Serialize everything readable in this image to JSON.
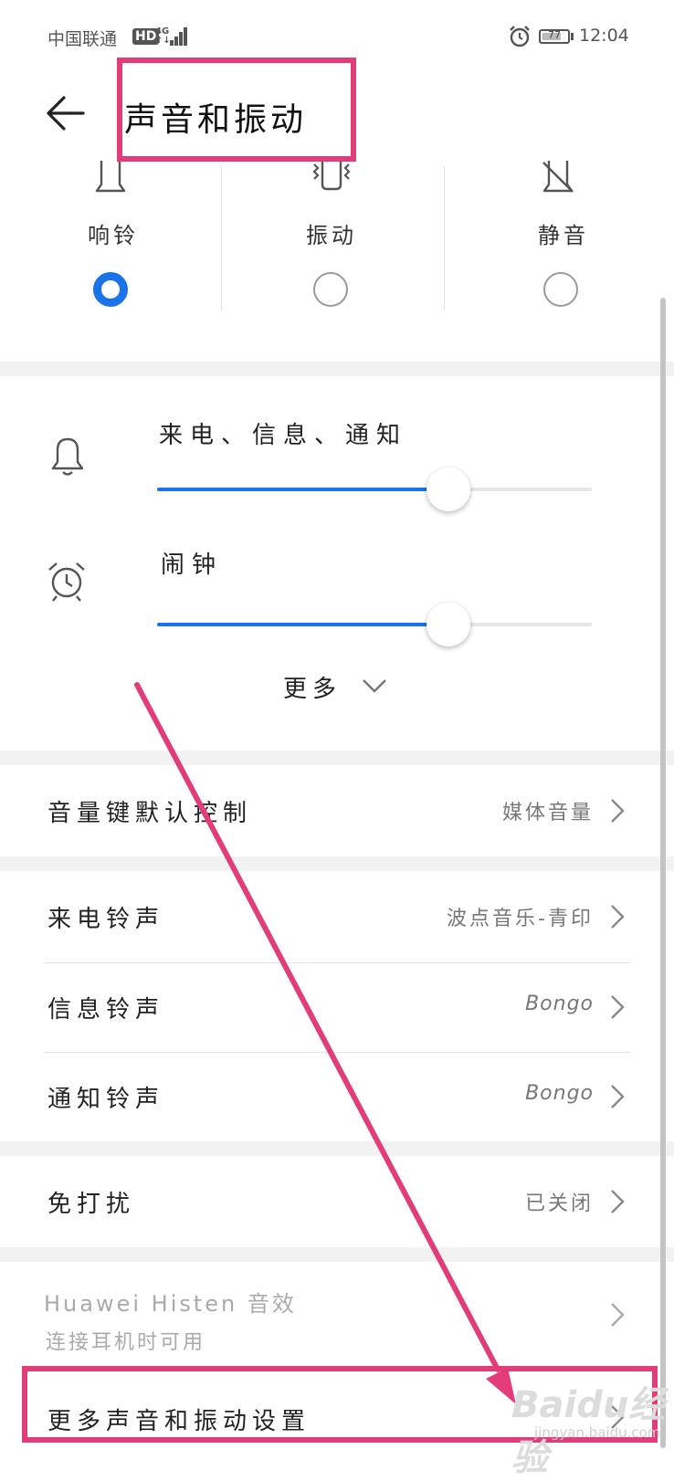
{
  "status_bar": {
    "carrier": "中国联通",
    "hd": "HD",
    "network_type": "4G",
    "battery_level": "77",
    "time": "12:04"
  },
  "header": {
    "title": "声音和振动"
  },
  "sound_modes": {
    "selected": "ring",
    "items": [
      {
        "id": "ring",
        "label": "响铃",
        "icon": "bell-icon"
      },
      {
        "id": "vibrate",
        "label": "振动",
        "icon": "vibrate-phone-icon"
      },
      {
        "id": "silent",
        "label": "静音",
        "icon": "bell-off-icon"
      }
    ]
  },
  "volume": {
    "sliders": [
      {
        "label": "来电、信息、通知",
        "icon": "bell-icon",
        "level": 0.67
      },
      {
        "label": "闹钟",
        "icon": "alarm-clock-icon",
        "level": 0.67
      }
    ],
    "more_label": "更多"
  },
  "settings": {
    "volume_key": {
      "label": "音量键默认控制",
      "value": "媒体音量"
    },
    "ringtone": {
      "label": "来电铃声",
      "value": "波点音乐-青印"
    },
    "message_tone": {
      "label": "信息铃声",
      "value": "Bongo"
    },
    "notification_tone": {
      "label": "通知铃声",
      "value": "Bongo"
    },
    "dnd": {
      "label": "免打扰",
      "value": "已关闭"
    },
    "histen": {
      "label": "Huawei Histen 音效",
      "sublabel": "连接耳机时可用"
    },
    "more_settings": {
      "label": "更多声音和振动设置"
    }
  },
  "colors": {
    "accent": "#1a73e8",
    "annotation": "#e23d7a"
  },
  "watermark": {
    "brand": "Baidu经验",
    "url": "jingyan.baidu.com"
  }
}
